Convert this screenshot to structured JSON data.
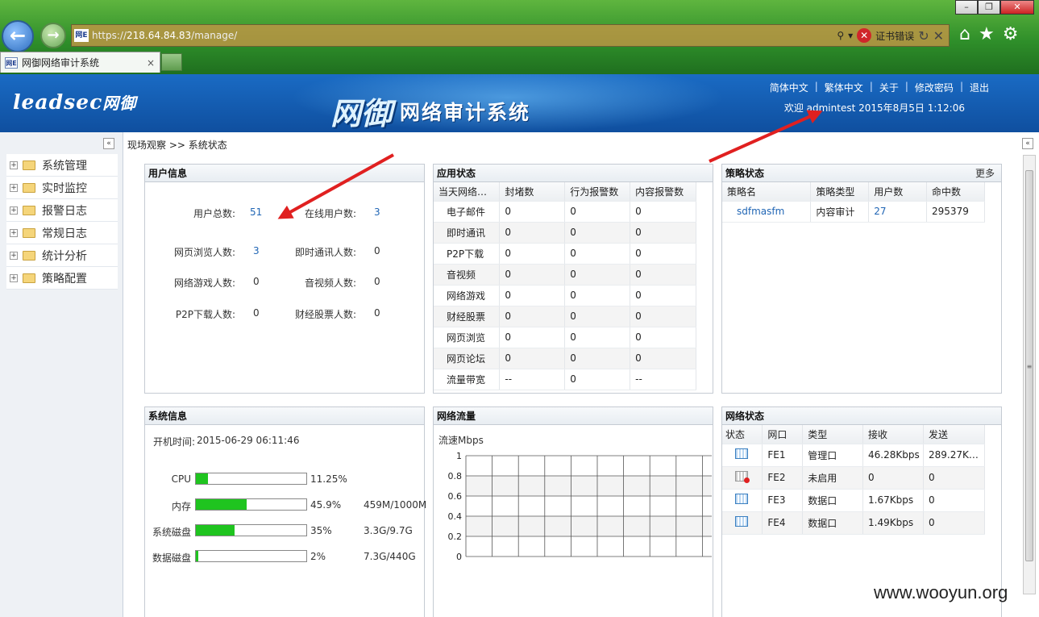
{
  "browser": {
    "url_prefix": "https://",
    "url_host": "218.64.84.83",
    "url_path": "/manage/",
    "cert_error": "证书错误",
    "tab_title": "网御网络审计系统",
    "site_icon_text": "网E"
  },
  "header": {
    "logo": "leadsec",
    "logo_cn": "网御",
    "title_big": "网御",
    "title": "网络审计系统",
    "links": [
      "简体中文",
      "繁体中文",
      "关于",
      "修改密码",
      "退出"
    ],
    "welcome": "欢迎 admintest 2015年8月5日 1:12:06"
  },
  "menu": [
    "系统管理",
    "实时监控",
    "报警日志",
    "常规日志",
    "统计分析",
    "策略配置"
  ],
  "breadcrumb": "现场观察 >> 系统状态",
  "user_info": {
    "title": "用户信息",
    "items": [
      {
        "label": "用户总数:",
        "value": "51"
      },
      {
        "label": "在线用户数:",
        "value": "3"
      },
      {
        "label": "网页浏览人数:",
        "value": "3"
      },
      {
        "label": "即时通讯人数:",
        "value": "0"
      },
      {
        "label": "网络游戏人数:",
        "value": "0"
      },
      {
        "label": "音视频人数:",
        "value": "0"
      },
      {
        "label": "P2P下载人数:",
        "value": "0"
      },
      {
        "label": "财经股票人数:",
        "value": "0"
      }
    ]
  },
  "app_status": {
    "title": "应用状态",
    "headers": [
      "当天网络…",
      "封堵数",
      "行为报警数",
      "内容报警数"
    ],
    "rows": [
      [
        "电子邮件",
        "0",
        "0",
        "0"
      ],
      [
        "即时通讯",
        "0",
        "0",
        "0"
      ],
      [
        "P2P下载",
        "0",
        "0",
        "0"
      ],
      [
        "音视频",
        "0",
        "0",
        "0"
      ],
      [
        "网络游戏",
        "0",
        "0",
        "0"
      ],
      [
        "财经股票",
        "0",
        "0",
        "0"
      ],
      [
        "网页浏览",
        "0",
        "0",
        "0"
      ],
      [
        "网页论坛",
        "0",
        "0",
        "0"
      ],
      [
        "流量带宽",
        "--",
        "0",
        "--"
      ]
    ]
  },
  "policy_status": {
    "title": "策略状态",
    "more": "更多",
    "headers": [
      "策略名",
      "策略类型",
      "用户数",
      "命中数"
    ],
    "rows": [
      [
        "sdfmasfm",
        "内容审计",
        "27",
        "295379"
      ]
    ]
  },
  "sys_info": {
    "title": "系统信息",
    "boot_label": "开机时间:",
    "boot_time": "2015-06-29 06:11:46",
    "bars": [
      {
        "label": "CPU",
        "percent": 11.25,
        "pct_text": "11.25%",
        "detail": ""
      },
      {
        "label": "内存",
        "percent": 45.9,
        "pct_text": "45.9%",
        "detail": "459M/1000M"
      },
      {
        "label": "系统磁盘",
        "percent": 35,
        "pct_text": "35%",
        "detail": "3.3G/9.7G"
      },
      {
        "label": "数据磁盘",
        "percent": 2,
        "pct_text": "2%",
        "detail": "7.3G/440G"
      }
    ]
  },
  "net_flow": {
    "title": "网络流量",
    "unit": "流速Mbps",
    "yticks": [
      "1",
      "0.8",
      "0.6",
      "0.4",
      "0.2",
      "0"
    ]
  },
  "net_status": {
    "title": "网络状态",
    "headers": [
      "状态",
      "网口",
      "类型",
      "接收",
      "发送"
    ],
    "rows": [
      {
        "status": "up",
        "port": "FE1",
        "type": "管理口",
        "rx": "46.28Kbps",
        "tx": "289.27K…"
      },
      {
        "status": "down",
        "port": "FE2",
        "type": "未启用",
        "rx": "0",
        "tx": "0"
      },
      {
        "status": "up",
        "port": "FE3",
        "type": "数据口",
        "rx": "1.67Kbps",
        "tx": "0"
      },
      {
        "status": "up",
        "port": "FE4",
        "type": "数据口",
        "rx": "1.49Kbps",
        "tx": "0"
      }
    ]
  },
  "watermark": "www.wooyun.org"
}
